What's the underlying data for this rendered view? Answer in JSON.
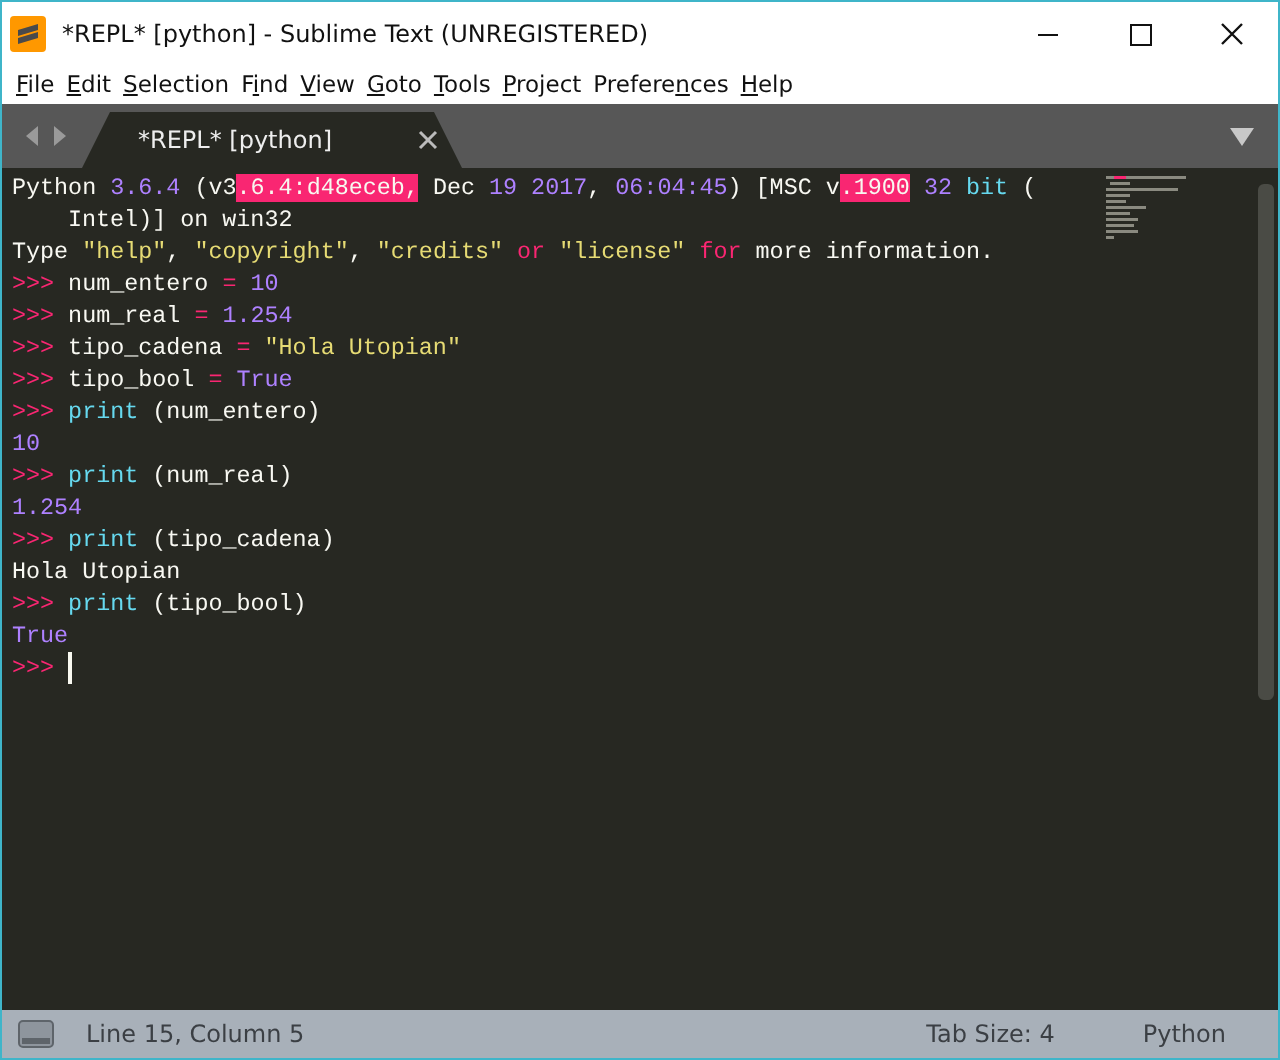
{
  "window": {
    "title": "*REPL* [python] - Sublime Text (UNREGISTERED)"
  },
  "menu": [
    {
      "parts": [
        {
          "text": "F",
          "underlined": true
        },
        {
          "text": "ile",
          "underlined": false
        }
      ]
    },
    {
      "parts": [
        {
          "text": "E",
          "underlined": true
        },
        {
          "text": "dit",
          "underlined": false
        }
      ]
    },
    {
      "parts": [
        {
          "text": "S",
          "underlined": true
        },
        {
          "text": "election",
          "underlined": false
        }
      ]
    },
    {
      "parts": [
        {
          "text": "F",
          "underlined": false
        },
        {
          "text": "i",
          "underlined": true
        },
        {
          "text": "nd",
          "underlined": false
        }
      ]
    },
    {
      "parts": [
        {
          "text": "V",
          "underlined": true
        },
        {
          "text": "iew",
          "underlined": false
        }
      ]
    },
    {
      "parts": [
        {
          "text": "G",
          "underlined": true
        },
        {
          "text": "oto",
          "underlined": false
        }
      ]
    },
    {
      "parts": [
        {
          "text": "T",
          "underlined": true
        },
        {
          "text": "ools",
          "underlined": false
        }
      ]
    },
    {
      "parts": [
        {
          "text": "P",
          "underlined": true
        },
        {
          "text": "roject",
          "underlined": false
        }
      ]
    },
    {
      "parts": [
        {
          "text": "Prefere",
          "underlined": false
        },
        {
          "text": "n",
          "underlined": true
        },
        {
          "text": "ces",
          "underlined": false
        }
      ]
    },
    {
      "parts": [
        {
          "text": "H",
          "underlined": true
        },
        {
          "text": "elp",
          "underlined": false
        }
      ]
    }
  ],
  "tabs": [
    {
      "label": "*REPL* [python]",
      "selected": true,
      "modified": true
    }
  ],
  "editor": {
    "lines": [
      {
        "kind": "line",
        "tokens": [
          {
            "text": "Python ",
            "kind": "plain"
          },
          {
            "text": "3.6.4",
            "kind": "number"
          },
          {
            "text": " (v3",
            "kind": "plain"
          },
          {
            "text": ".6.4:d48eceb,",
            "kind": "error"
          },
          {
            "text": " Dec ",
            "kind": "plain"
          },
          {
            "text": "19 2017",
            "kind": "number"
          },
          {
            "text": ", ",
            "kind": "plain"
          },
          {
            "text": "06:04:45",
            "kind": "number"
          },
          {
            "text": ") [MSC v",
            "kind": "plain"
          },
          {
            "text": ".1900",
            "kind": "error"
          },
          {
            "text": " 32",
            "kind": "number"
          },
          {
            "text": " bit",
            "kind": "keyword"
          },
          {
            "text": " (",
            "kind": "plain"
          }
        ]
      },
      {
        "kind": "continuation",
        "tokens": [
          {
            "text": "Intel)] on win32",
            "kind": "plain"
          }
        ]
      },
      {
        "kind": "line",
        "tokens": [
          {
            "text": "Type ",
            "kind": "plain"
          },
          {
            "text": "\"help\"",
            "kind": "string"
          },
          {
            "text": ", ",
            "kind": "plain"
          },
          {
            "text": "\"copyright\"",
            "kind": "string"
          },
          {
            "text": ", ",
            "kind": "plain"
          },
          {
            "text": "\"credits\"",
            "kind": "string"
          },
          {
            "text": " or",
            "kind": "operator"
          },
          {
            "text": " \"license\"",
            "kind": "string"
          },
          {
            "text": " for",
            "kind": "operator"
          },
          {
            "text": " more information.",
            "kind": "plain"
          }
        ]
      },
      {
        "kind": "line",
        "tokens": [
          {
            "text": ">>>",
            "kind": "prompt"
          },
          {
            "text": " num_entero ",
            "kind": "plain"
          },
          {
            "text": "=",
            "kind": "operator"
          },
          {
            "text": " 10",
            "kind": "number"
          }
        ]
      },
      {
        "kind": "line",
        "tokens": [
          {
            "text": ">>>",
            "kind": "prompt"
          },
          {
            "text": " num_real ",
            "kind": "plain"
          },
          {
            "text": "=",
            "kind": "operator"
          },
          {
            "text": " 1.254",
            "kind": "number"
          }
        ]
      },
      {
        "kind": "line",
        "tokens": [
          {
            "text": ">>>",
            "kind": "prompt"
          },
          {
            "text": " tipo_cadena ",
            "kind": "plain"
          },
          {
            "text": "=",
            "kind": "operator"
          },
          {
            "text": " \"Hola Utopian\"",
            "kind": "string"
          }
        ]
      },
      {
        "kind": "line",
        "tokens": [
          {
            "text": ">>>",
            "kind": "prompt"
          },
          {
            "text": " tipo_bool ",
            "kind": "plain"
          },
          {
            "text": "=",
            "kind": "operator"
          },
          {
            "text": " True",
            "kind": "number"
          }
        ]
      },
      {
        "kind": "line",
        "tokens": [
          {
            "text": ">>>",
            "kind": "prompt"
          },
          {
            "text": " print",
            "kind": "keyword"
          },
          {
            "text": " (num_entero)",
            "kind": "plain"
          }
        ]
      },
      {
        "kind": "line",
        "tokens": [
          {
            "text": "10",
            "kind": "number"
          }
        ]
      },
      {
        "kind": "line",
        "tokens": [
          {
            "text": ">>>",
            "kind": "prompt"
          },
          {
            "text": " print",
            "kind": "keyword"
          },
          {
            "text": " (num_real)",
            "kind": "plain"
          }
        ]
      },
      {
        "kind": "line",
        "tokens": [
          {
            "text": "1.254",
            "kind": "number"
          }
        ]
      },
      {
        "kind": "line",
        "tokens": [
          {
            "text": ">>>",
            "kind": "prompt"
          },
          {
            "text": " print",
            "kind": "keyword"
          },
          {
            "text": " (tipo_cadena)",
            "kind": "plain"
          }
        ]
      },
      {
        "kind": "line",
        "tokens": [
          {
            "text": "Hola Utopian",
            "kind": "plain"
          }
        ]
      },
      {
        "kind": "line",
        "tokens": [
          {
            "text": ">>>",
            "kind": "prompt"
          },
          {
            "text": " print",
            "kind": "keyword"
          },
          {
            "text": " (tipo_bool)",
            "kind": "plain"
          }
        ]
      },
      {
        "kind": "line",
        "tokens": [
          {
            "text": "True",
            "kind": "number"
          }
        ]
      },
      {
        "kind": "line",
        "cursor": true,
        "tokens": [
          {
            "text": ">>> ",
            "kind": "prompt"
          }
        ]
      }
    ]
  },
  "status_bar": {
    "position": "Line 15, Column 5",
    "tab_size": "Tab Size: 4",
    "syntax": "Python"
  }
}
